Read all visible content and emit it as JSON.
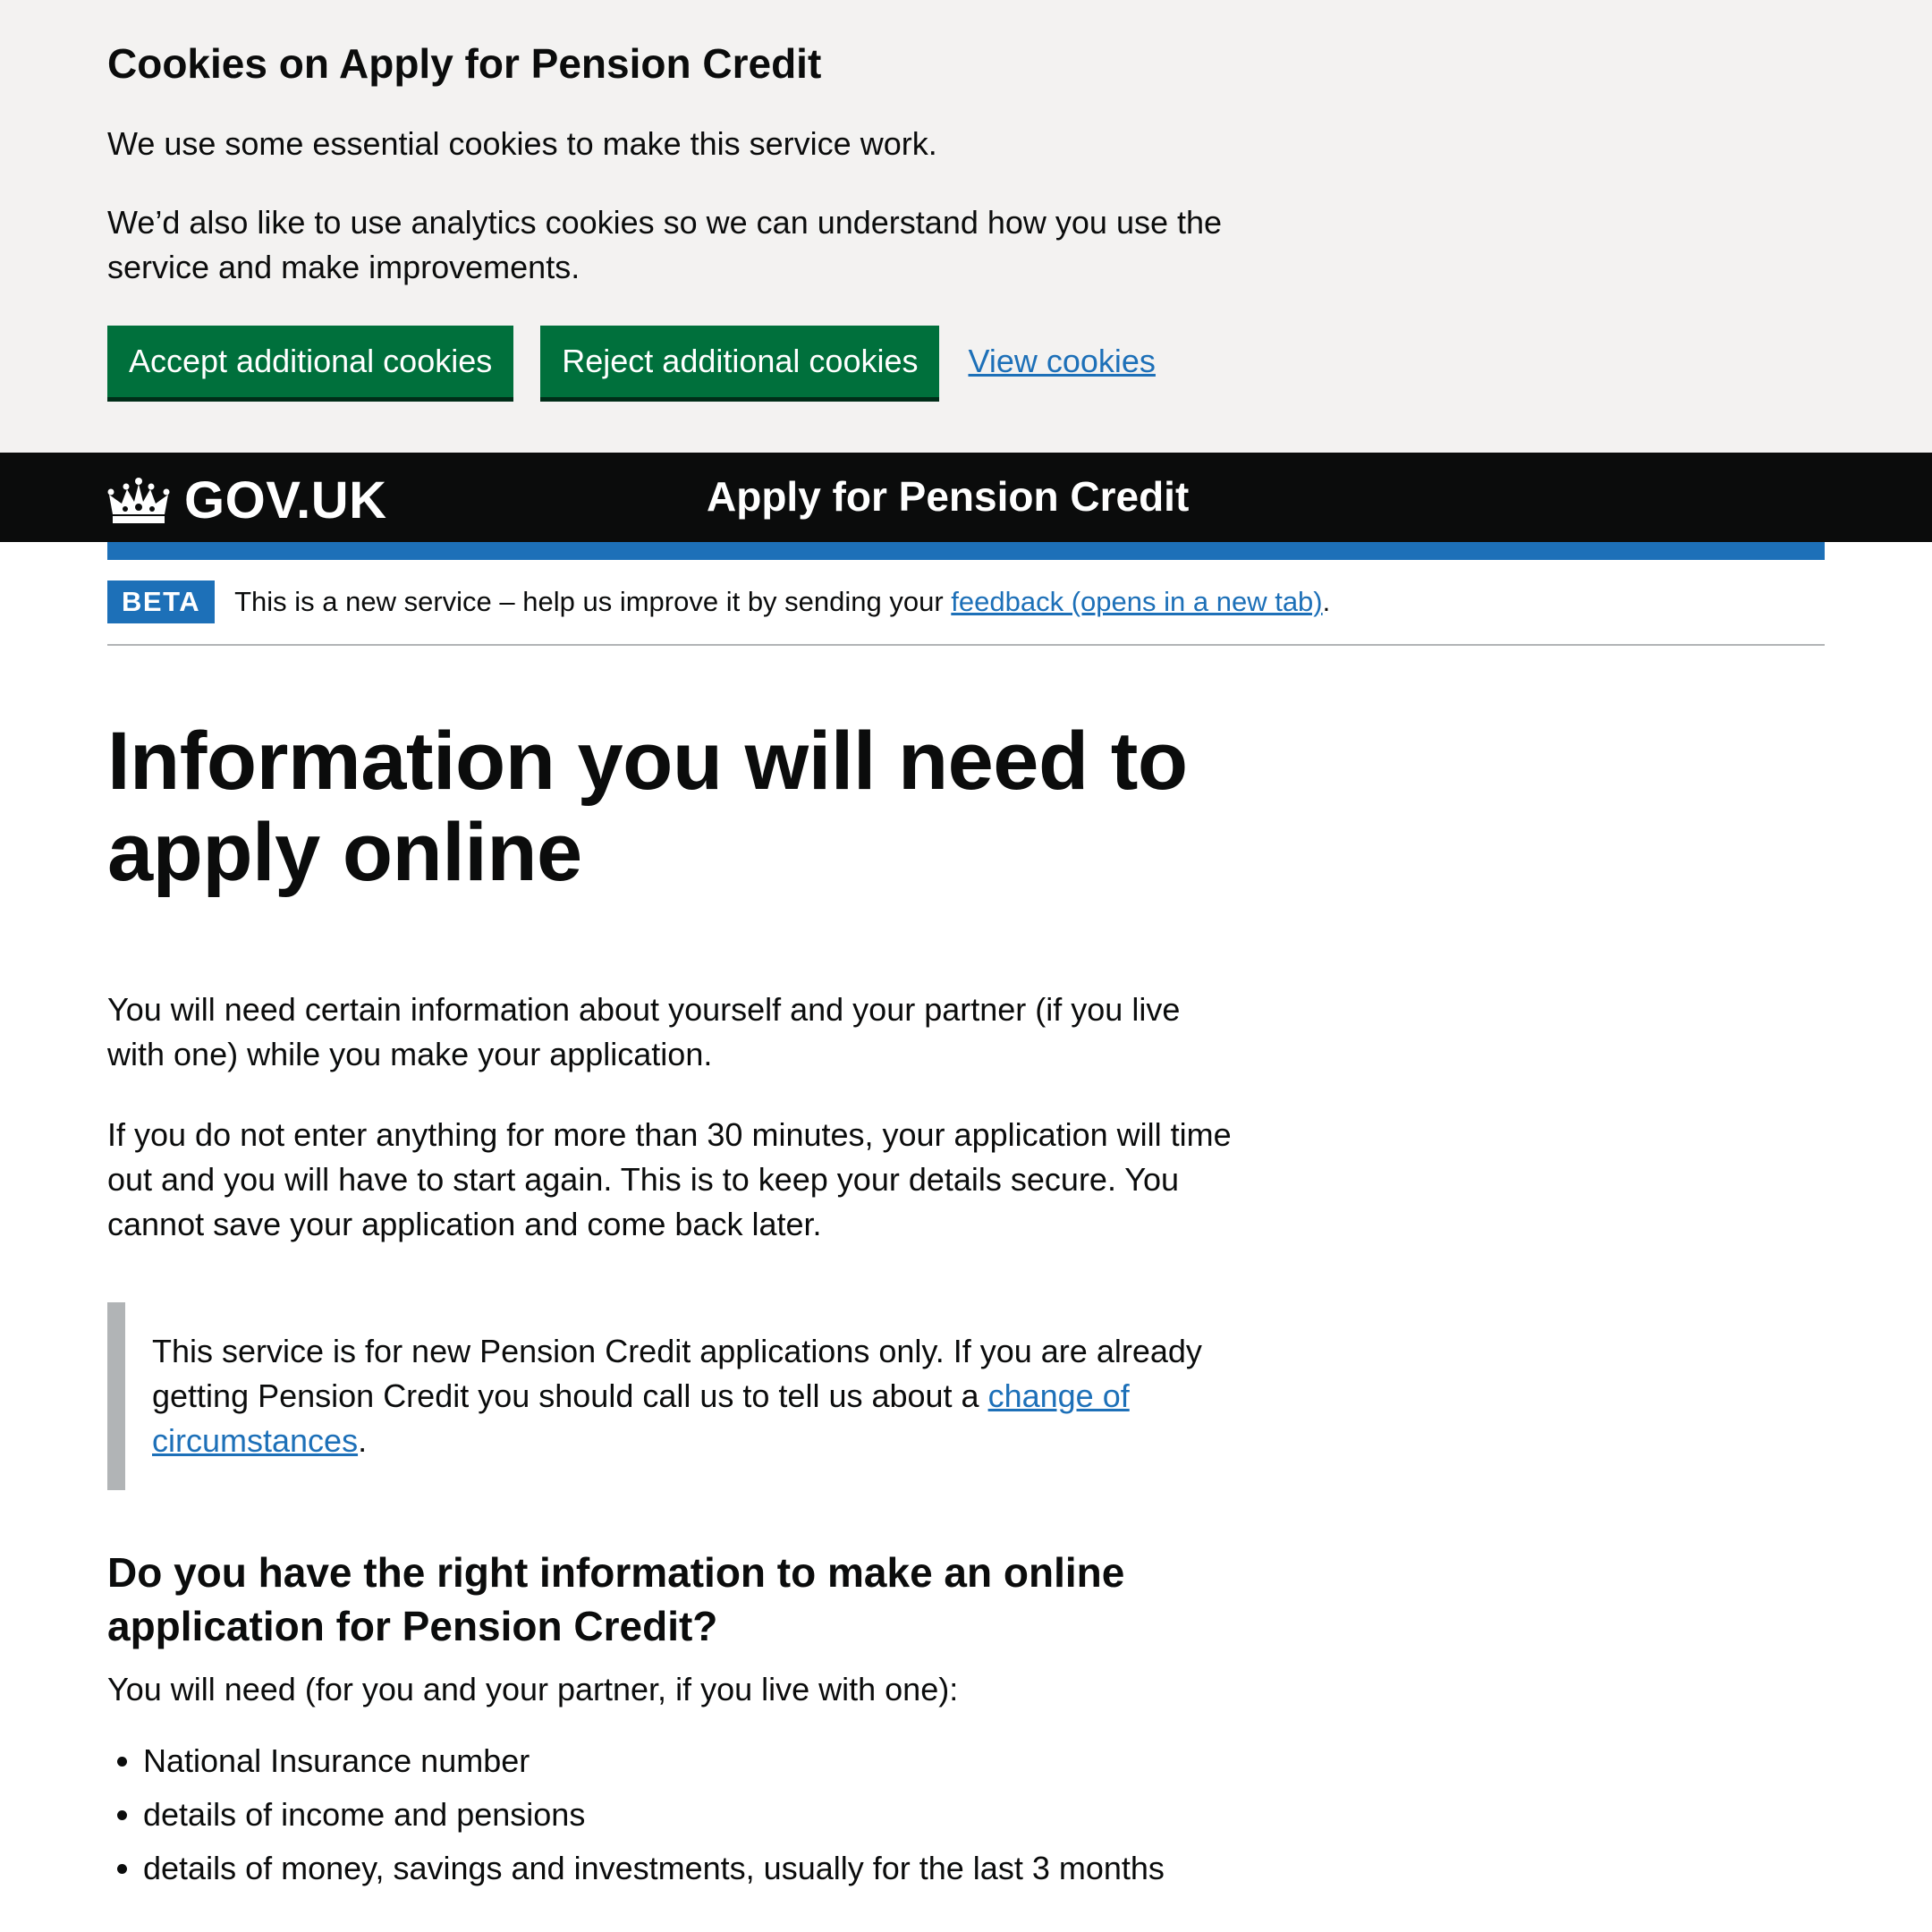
{
  "cookie_banner": {
    "title": "Cookies on Apply for Pension Credit",
    "paragraph1": "We use some essential cookies to make this service work.",
    "paragraph2": "We’d also like to use analytics cookies so we can understand how you use the service and make improvements.",
    "accept_label": "Accept additional cookies",
    "reject_label": "Reject additional cookies",
    "view_label": "View cookies"
  },
  "header": {
    "logo_text": "GOV.UK",
    "logo_icon": "crown-icon",
    "service_name": "Apply for Pension Credit"
  },
  "phase_banner": {
    "tag": "BETA",
    "text_before": "This is a new service – help us improve it by sending your ",
    "link": "feedback (opens in a new tab)",
    "text_after": "."
  },
  "main": {
    "title": "Information you will need to apply online",
    "intro1": "You will need certain information about yourself and your partner (if you live with one) while you make your application.",
    "intro2": "If you do not enter anything for more than 30 minutes, your application will time out and you will have to start again. This is to keep your details secure. You cannot save your application and come back later.",
    "inset": {
      "text_before": "This service is for new Pension Credit applications only. If you are already getting Pension Credit you should call us to tell us about a ",
      "link": "change of circumstances",
      "text_after": "."
    },
    "section_heading": "Do you have the right information to make an online application for Pension Credit?",
    "need_intro": "You will need (for you and your partner, if you live with one):",
    "need_items": [
      "National Insurance number",
      "details of income and pensions",
      "details of money, savings and investments, usually for the last 3 months"
    ]
  },
  "colors": {
    "button_green": "#00703c",
    "link_blue": "#1d70b8",
    "header_black": "#0b0c0c",
    "banner_grey": "#f3f2f1"
  }
}
